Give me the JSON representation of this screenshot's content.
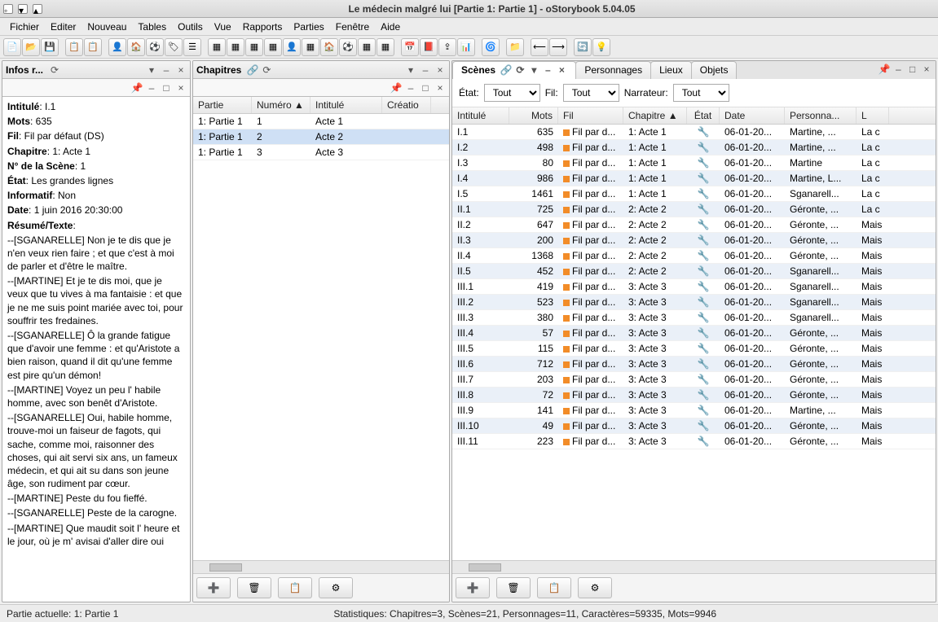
{
  "window": {
    "title": "Le médecin malgré lui [Partie 1: Partie 1] - oStorybook 5.04.05"
  },
  "menu": [
    "Fichier",
    "Editer",
    "Nouveau",
    "Tables",
    "Outils",
    "Vue",
    "Rapports",
    "Parties",
    "Fenêtre",
    "Aide"
  ],
  "panels": {
    "info": {
      "title": "Infos r..."
    },
    "chap": {
      "title": "Chapitres"
    },
    "scenes": {
      "title": "Scènes"
    },
    "tabs": [
      "Scènes",
      "Personnages",
      "Lieux",
      "Objets"
    ]
  },
  "info": {
    "fields": {
      "intitule_l": "Intitulé",
      "intitule_v": "I.1",
      "mots_l": "Mots",
      "mots_v": "635",
      "fil_l": "Fil",
      "fil_v": "Fil par défaut (DS)",
      "chapitre_l": "Chapitre",
      "chapitre_v": "1: Acte 1",
      "nscene_l": "N° de la Scène",
      "nscene_v": "1",
      "etat_l": "État",
      "etat_v": "Les grandes lignes",
      "info_l": "Informatif",
      "info_v": "Non",
      "date_l": "Date",
      "date_v": "1 juin 2016 20:30:00",
      "resume_l": "Résumé/Texte"
    },
    "body": [
      "--[SGANARELLE] Non je te dis que je n'en veux rien faire ; et que c'est à moi de parler et d'être le maître.",
      "--[MARTINE] Et je te dis moi, que je veux que tu vives à ma fantaisie : et que je ne me suis point mariée avec toi, pour souffrir tes fredaines.",
      "--[SGANARELLE] Ô la grande fatigue que d'avoir une femme : et qu'Aristote a bien raison, quand il dit qu'une femme est pire qu'un démon!",
      "--[MARTINE] Voyez un peu l' habile homme, avec son benêt d'Aristote.",
      "--[SGANARELLE] Oui, habile homme, trouve-moi un faiseur de fagots, qui sache, comme moi, raisonner des choses, qui ait servi six ans, un fameux médecin, et qui ait su dans son jeune âge, son rudiment par cœur.",
      "--[MARTINE] Peste du fou fieffé.",
      "--[SGANARELLE] Peste de la carogne.",
      "--[MARTINE] Que maudit soit l' heure et le jour, où je m' avisai d'aller dire oui"
    ]
  },
  "chapitres": {
    "headers": [
      "Partie",
      "Numéro ▲",
      "Intitulé",
      "Créatio"
    ],
    "rows": [
      {
        "partie": "1: Partie 1",
        "num": "1",
        "intitule": "Acte 1",
        "sel": false
      },
      {
        "partie": "1: Partie 1",
        "num": "2",
        "intitule": "Acte 2",
        "sel": true
      },
      {
        "partie": "1: Partie 1",
        "num": "3",
        "intitule": "Acte 3",
        "sel": false
      }
    ]
  },
  "filters": {
    "etat_l": "État:",
    "etat_v": "Tout",
    "fil_l": "Fil:",
    "fil_v": "Tout",
    "narr_l": "Narrateur:",
    "narr_v": "Tout"
  },
  "scenes": {
    "headers": [
      "Intitulé",
      "Mots",
      "Fil",
      "Chapitre ▲",
      "État",
      "Date",
      "Personna...",
      "L"
    ],
    "rows": [
      {
        "i": "I.1",
        "m": "635",
        "f": "Fil par d...",
        "c": "1: Acte 1",
        "d": "06-01-20...",
        "p": "Martine, ...",
        "l": "La c"
      },
      {
        "i": "I.2",
        "m": "498",
        "f": "Fil par d...",
        "c": "1: Acte 1",
        "d": "06-01-20...",
        "p": "Martine, ...",
        "l": "La c"
      },
      {
        "i": "I.3",
        "m": "80",
        "f": "Fil par d...",
        "c": "1: Acte 1",
        "d": "06-01-20...",
        "p": "Martine",
        "l": "La c"
      },
      {
        "i": "I.4",
        "m": "986",
        "f": "Fil par d...",
        "c": "1: Acte 1",
        "d": "06-01-20...",
        "p": "Martine, L...",
        "l": "La c"
      },
      {
        "i": "I.5",
        "m": "1461",
        "f": "Fil par d...",
        "c": "1: Acte 1",
        "d": "06-01-20...",
        "p": "Sganarell...",
        "l": "La c"
      },
      {
        "i": "II.1",
        "m": "725",
        "f": "Fil par d...",
        "c": "2: Acte 2",
        "d": "06-01-20...",
        "p": "Géronte, ...",
        "l": "La c"
      },
      {
        "i": "II.2",
        "m": "647",
        "f": "Fil par d...",
        "c": "2: Acte 2",
        "d": "06-01-20...",
        "p": "Géronte, ...",
        "l": "Mais"
      },
      {
        "i": "II.3",
        "m": "200",
        "f": "Fil par d...",
        "c": "2: Acte 2",
        "d": "06-01-20...",
        "p": "Géronte, ...",
        "l": "Mais"
      },
      {
        "i": "II.4",
        "m": "1368",
        "f": "Fil par d...",
        "c": "2: Acte 2",
        "d": "06-01-20...",
        "p": "Géronte, ...",
        "l": "Mais"
      },
      {
        "i": "II.5",
        "m": "452",
        "f": "Fil par d...",
        "c": "2: Acte 2",
        "d": "06-01-20...",
        "p": "Sganarell...",
        "l": "Mais"
      },
      {
        "i": "III.1",
        "m": "419",
        "f": "Fil par d...",
        "c": "3: Acte 3",
        "d": "06-01-20...",
        "p": "Sganarell...",
        "l": "Mais"
      },
      {
        "i": "III.2",
        "m": "523",
        "f": "Fil par d...",
        "c": "3: Acte 3",
        "d": "06-01-20...",
        "p": "Sganarell...",
        "l": "Mais"
      },
      {
        "i": "III.3",
        "m": "380",
        "f": "Fil par d...",
        "c": "3: Acte 3",
        "d": "06-01-20...",
        "p": "Sganarell...",
        "l": "Mais"
      },
      {
        "i": "III.4",
        "m": "57",
        "f": "Fil par d...",
        "c": "3: Acte 3",
        "d": "06-01-20...",
        "p": "Géronte, ...",
        "l": "Mais"
      },
      {
        "i": "III.5",
        "m": "115",
        "f": "Fil par d...",
        "c": "3: Acte 3",
        "d": "06-01-20...",
        "p": "Géronte, ...",
        "l": "Mais"
      },
      {
        "i": "III.6",
        "m": "712",
        "f": "Fil par d...",
        "c": "3: Acte 3",
        "d": "06-01-20...",
        "p": "Géronte, ...",
        "l": "Mais"
      },
      {
        "i": "III.7",
        "m": "203",
        "f": "Fil par d...",
        "c": "3: Acte 3",
        "d": "06-01-20...",
        "p": "Géronte, ...",
        "l": "Mais"
      },
      {
        "i": "III.8",
        "m": "72",
        "f": "Fil par d...",
        "c": "3: Acte 3",
        "d": "06-01-20...",
        "p": "Géronte, ...",
        "l": "Mais"
      },
      {
        "i": "III.9",
        "m": "141",
        "f": "Fil par d...",
        "c": "3: Acte 3",
        "d": "06-01-20...",
        "p": "Martine, ...",
        "l": "Mais"
      },
      {
        "i": "III.10",
        "m": "49",
        "f": "Fil par d...",
        "c": "3: Acte 3",
        "d": "06-01-20...",
        "p": "Géronte, ...",
        "l": "Mais"
      },
      {
        "i": "III.11",
        "m": "223",
        "f": "Fil par d...",
        "c": "3: Acte 3",
        "d": "06-01-20...",
        "p": "Géronte, ...",
        "l": "Mais"
      }
    ]
  },
  "status": {
    "partie": "Partie actuelle: 1: Partie 1",
    "stats": "Statistiques: Chapitres=3,  Scènes=21,  Personnages=11,  Caractères=59335,  Mots=9946"
  }
}
